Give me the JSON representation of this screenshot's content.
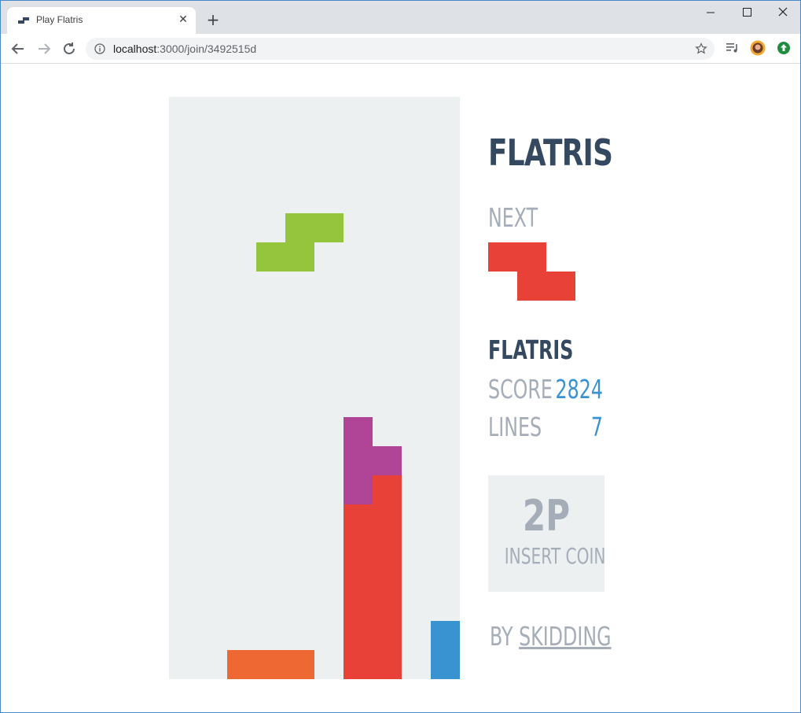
{
  "browser": {
    "tab_title": "Play Flatris",
    "tab_close": "✕",
    "new_tab": "+",
    "url_host": "localhost",
    "url_path": ":3000/join/3492515d"
  },
  "game": {
    "title": "FLATRIS",
    "next_label": "NEXT",
    "player_name": "FLATRIS",
    "score_label": "SCORE",
    "score_value": "2824",
    "lines_label": "LINES",
    "lines_value": "7",
    "coin_title": "2P",
    "coin_text": "INSERT COIN",
    "credits_by": "BY",
    "credits_author": "SKIDDING"
  },
  "colors": {
    "well_bg": "#ecf0f1",
    "title": "#34495f",
    "muted": "#a5adb8",
    "value": "#3993d0",
    "green": "#95c43d",
    "red": "#e84138",
    "purple": "#b04497",
    "orange": "#ed6832",
    "blue": "#3993d0"
  },
  "board": {
    "columns": 10,
    "rows": 20,
    "falling_piece": {
      "type": "S",
      "color": "green",
      "cells": [
        [
          4,
          4
        ],
        [
          5,
          4
        ],
        [
          3,
          5
        ],
        [
          4,
          5
        ]
      ]
    },
    "settled_cells": [
      {
        "col": 6,
        "row": 11,
        "color": "purple"
      },
      {
        "col": 6,
        "row": 12,
        "color": "purple"
      },
      {
        "col": 7,
        "row": 12,
        "color": "purple"
      },
      {
        "col": 6,
        "row": 13,
        "color": "purple"
      },
      {
        "col": 7,
        "row": 13,
        "color": "red"
      },
      {
        "col": 6,
        "row": 14,
        "color": "red"
      },
      {
        "col": 7,
        "row": 14,
        "color": "red"
      },
      {
        "col": 6,
        "row": 15,
        "color": "red"
      },
      {
        "col": 7,
        "row": 15,
        "color": "red"
      },
      {
        "col": 6,
        "row": 16,
        "color": "red"
      },
      {
        "col": 7,
        "row": 16,
        "color": "red"
      },
      {
        "col": 6,
        "row": 17,
        "color": "red"
      },
      {
        "col": 7,
        "row": 17,
        "color": "red"
      },
      {
        "col": 6,
        "row": 18,
        "color": "red"
      },
      {
        "col": 7,
        "row": 18,
        "color": "red"
      },
      {
        "col": 6,
        "row": 19,
        "color": "red"
      },
      {
        "col": 7,
        "row": 19,
        "color": "red"
      },
      {
        "col": 2,
        "row": 19,
        "color": "orange"
      },
      {
        "col": 3,
        "row": 19,
        "color": "orange"
      },
      {
        "col": 4,
        "row": 19,
        "color": "orange"
      },
      {
        "col": 9,
        "row": 18,
        "color": "blue"
      },
      {
        "col": 9,
        "row": 19,
        "color": "blue"
      }
    ]
  },
  "next_piece": {
    "type": "Z",
    "color": "red",
    "cells": [
      [
        0,
        0
      ],
      [
        1,
        0
      ],
      [
        1,
        1
      ],
      [
        2,
        1
      ]
    ]
  }
}
